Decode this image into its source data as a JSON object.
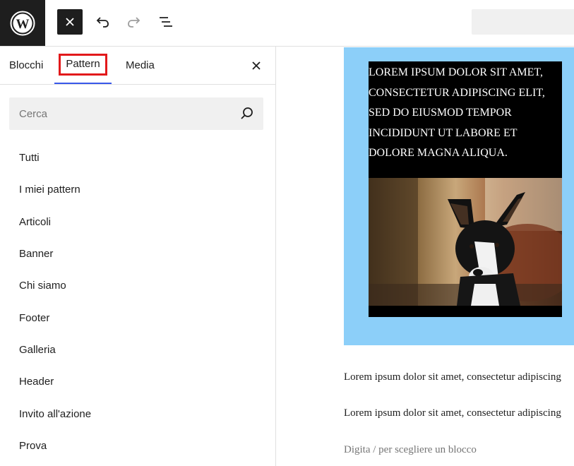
{
  "toolbar": {
    "logo_icon": "wordpress-logo",
    "close_icon": "close-icon",
    "undo_icon": "undo-icon",
    "redo_icon": "redo-icon",
    "list_view_icon": "list-view-icon"
  },
  "inserter": {
    "tabs": [
      {
        "label": "Blocchi"
      },
      {
        "label": "Pattern"
      },
      {
        "label": "Media"
      }
    ],
    "active_tab": "Pattern",
    "search": {
      "placeholder": "Cerca",
      "value": ""
    },
    "categories": [
      {
        "label": "Tutti"
      },
      {
        "label": "I miei pattern"
      },
      {
        "label": "Articoli"
      },
      {
        "label": "Banner"
      },
      {
        "label": "Chi siamo"
      },
      {
        "label": "Footer"
      },
      {
        "label": "Galleria"
      },
      {
        "label": "Header"
      },
      {
        "label": "Invito all'azione"
      },
      {
        "label": "Prova"
      }
    ]
  },
  "editor": {
    "cover_text": "LOREM IPSUM DOLOR SIT AMET, CONSECTETUR ADIPISCING ELIT, SED DO EIUSMOD TEMPOR INCIDIDUNT UT LABORE ET DOLORE MAGNA ALIQUA.",
    "cover_background": "#8ccff9",
    "image_alt": "black and white dog",
    "paragraphs": [
      "Lorem ipsum dolor sit amet, consectetur adipiscing",
      "Lorem ipsum dolor sit amet, consectetur adipiscing"
    ],
    "block_placeholder": "Digita / per scegliere un blocco"
  },
  "colors": {
    "accent": "#3858e9",
    "highlight": "#e2191b",
    "dark": "#1e1e1e"
  }
}
